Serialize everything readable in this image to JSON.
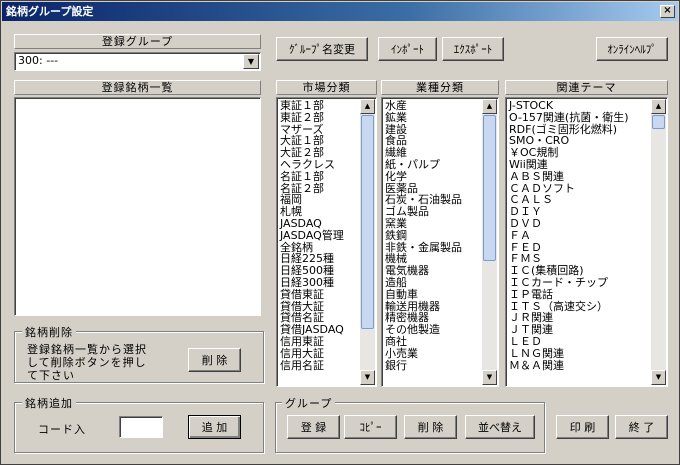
{
  "window": {
    "title": "銘柄グループ設定",
    "close_label": "×"
  },
  "toolbar": {
    "rename_label": "ｸﾞﾙｰﾌﾟ名変更",
    "import_label": "ｲﾝﾎﾟｰﾄ",
    "export_label": "ｴｸｽﾎﾟｰﾄ",
    "help_label": "ｵﾝﾗｲﾝﾍﾙﾌﾟ"
  },
  "registered_group": {
    "header": "登録グループ",
    "selected": "300:  ---"
  },
  "registered_list": {
    "header": "登録銘柄一覧",
    "items": []
  },
  "market": {
    "header": "市場分類",
    "items": [
      "東証１部",
      "東証２部",
      "マザーズ",
      "大証１部",
      "大証２部",
      "ヘラクレス",
      "名証１部",
      "名証２部",
      "福岡",
      "札幌",
      "JASDAQ",
      "JASDAQ管理",
      "全銘柄",
      "日経225種",
      "日経500種",
      "日経300種",
      "貸借東証",
      "貸借大証",
      "貸借名証",
      "貸借JASDAQ",
      "信用東証",
      "信用大証",
      "信用名証"
    ]
  },
  "industry": {
    "header": "業種分類",
    "items": [
      "水産",
      "鉱業",
      "建設",
      "食品",
      "繊維",
      "紙・パルプ",
      "化学",
      "医薬品",
      "石炭・石油製品",
      "ゴム製品",
      "窯業",
      "鉄鋼",
      "非鉄・金属製品",
      "機械",
      "電気機器",
      "造船",
      "自動車",
      "輸送用機器",
      "精密機器",
      "その他製造",
      "商社",
      "小売業",
      "銀行"
    ]
  },
  "theme": {
    "header": "関連テーマ",
    "items": [
      "J-STOCK",
      "O-157関連(抗菌・衛生)",
      "RDF(ゴミ固形化燃料)",
      "SMO・CRO",
      "￥OC規制",
      "Wii関連",
      "ＡＢＳ関連",
      "ＣＡＤソフト",
      "ＣＡＬＳ",
      "ＤＩＹ",
      "ＤＶＤ",
      "ＦＡ",
      "ＦＥＤ",
      "ＦＭＳ",
      "ＩＣ(集積回路)",
      "ＩＣカード・チップ",
      "ＩＰ電話",
      "ＩＴＳ（高速交シ）",
      "ＪＲ関連",
      "ＪＴ関連",
      "ＬＥＤ",
      "ＬＮＧ関連",
      "Ｍ＆Ａ関連"
    ]
  },
  "delete_group": {
    "label": "銘柄削除",
    "instruction_1": "登録銘柄一覧から選択",
    "instruction_2": "して削除ボタンを押し",
    "instruction_3": "て下さい",
    "button": "削 除"
  },
  "add_group": {
    "label": "銘柄追加",
    "code_label": "コード入",
    "code_value": "",
    "button": "追 加"
  },
  "group_box": {
    "label": "グループ",
    "register": "登 録",
    "copy": "ｺﾋﾟｰ",
    "delete": "削 除",
    "sort": "並べ替え"
  },
  "footer": {
    "print": "印 刷",
    "close": "終 了"
  }
}
